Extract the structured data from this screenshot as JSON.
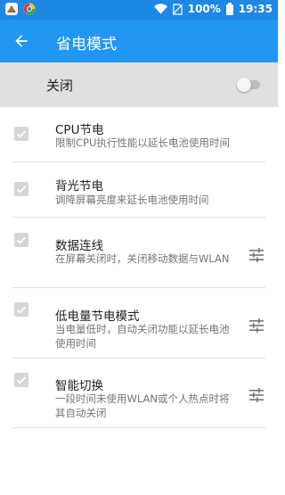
{
  "status_bar": {
    "battery_percent": "100%",
    "time": "19:35",
    "icons": [
      "app-icon-colorful",
      "browser-icon",
      "wifi-icon",
      "no-sim-icon",
      "battery-icon"
    ]
  },
  "app_bar": {
    "title": "省电模式",
    "back_icon": "arrow-left-icon"
  },
  "master_switch": {
    "label": "关闭",
    "on": false
  },
  "items": [
    {
      "title": "CPU节电",
      "subtitle": "限制CPU执行性能以延长电池使用时间",
      "checked": true,
      "has_settings": false
    },
    {
      "title": "背光节电",
      "subtitle": "调降屏幕亮度来延长电池使用时间",
      "checked": true,
      "has_settings": false
    },
    {
      "title": "数据连线",
      "subtitle": "在屏幕关闭时，关闭移动数据与WLAN",
      "checked": true,
      "has_settings": true
    },
    {
      "title": "低电量节电模式",
      "subtitle": "当电量低时，自动关闭功能以延长电池使用时间",
      "checked": true,
      "has_settings": true
    },
    {
      "title": "智能切换",
      "subtitle": "一段时间未使用WLAN或个人热点时将其自动关闭",
      "checked": true,
      "has_settings": true
    }
  ],
  "colors": {
    "status_bar": "#1e88e5",
    "app_bar": "#2196f3",
    "master_row": "#e0e0e0",
    "checkbox_disabled": "#d6d6d6"
  }
}
